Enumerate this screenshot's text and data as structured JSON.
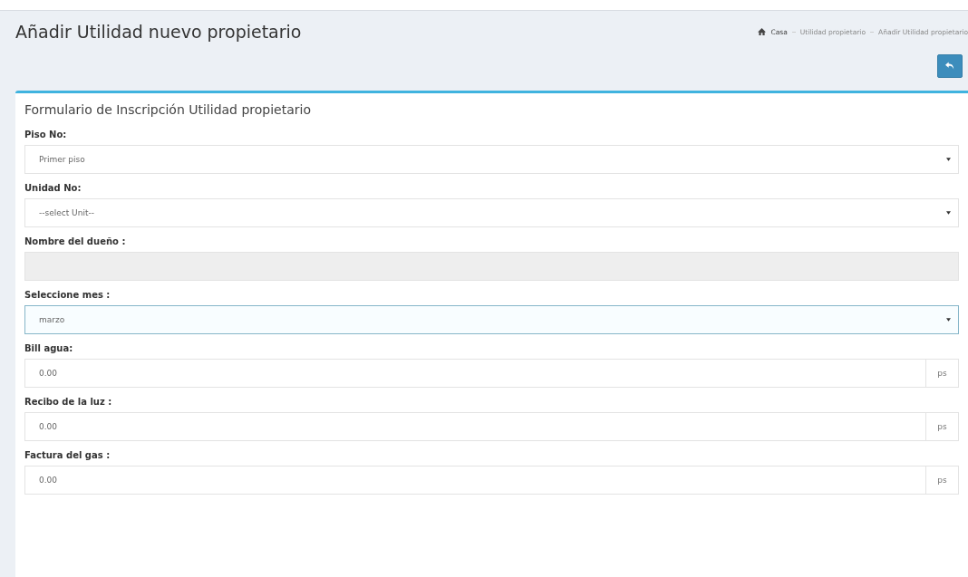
{
  "page": {
    "title": "Añadir Utilidad nuevo propietario"
  },
  "breadcrumb": [
    {
      "label": "Casa",
      "kind": "home"
    },
    {
      "label": "Utilidad propietario",
      "kind": "link"
    },
    {
      "label": "Añadir Utilidad propietario",
      "kind": "link"
    }
  ],
  "form": {
    "title": "Formulario de Inscripción Utilidad propietario",
    "fields": [
      {
        "label": "Piso No:",
        "kind": "select",
        "value": "Primer piso",
        "disabled": false,
        "focused": false
      },
      {
        "label": "Unidad No:",
        "kind": "select",
        "value": "--select Unit--",
        "disabled": false,
        "focused": false
      },
      {
        "label": "Nombre del dueño :",
        "kind": "text",
        "disabled": true,
        "focused": false
      },
      {
        "label": "Seleccione mes :",
        "kind": "select",
        "value": "marzo",
        "disabled": false,
        "focused": true
      },
      {
        "label": "Bill agua:",
        "kind": "addon",
        "value": "0.00",
        "addon": "ps",
        "disabled": false,
        "focused": false
      },
      {
        "label": "Recibo de la luz :",
        "kind": "addon",
        "value": "0.00",
        "addon": "ps",
        "disabled": false,
        "focused": false
      },
      {
        "label": "Factura del gas :",
        "kind": "addon",
        "value": "0.00",
        "addon": "ps",
        "disabled": false,
        "focused": false
      }
    ]
  }
}
